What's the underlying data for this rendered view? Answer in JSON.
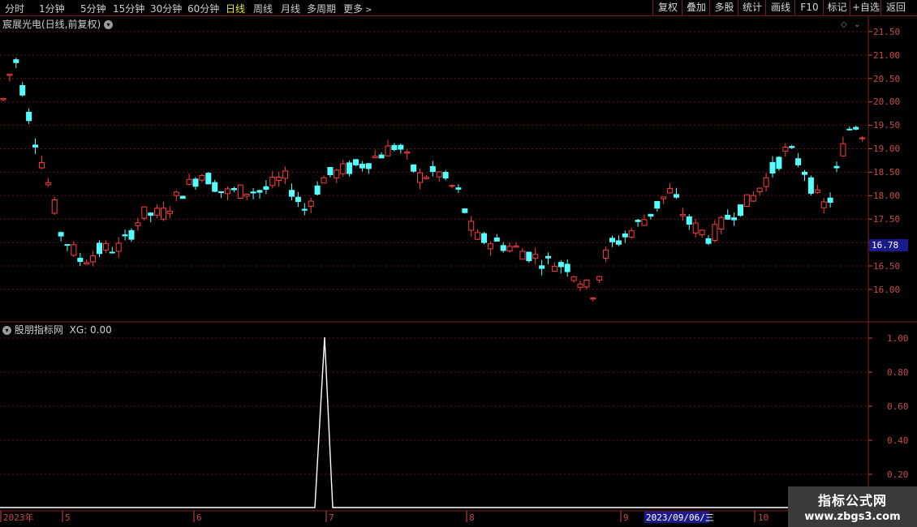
{
  "toolbar": {
    "timeframes": [
      "分时",
      "1分钟",
      "5分钟",
      "15分钟",
      "30分钟",
      "60分钟",
      "日线",
      "周线",
      "月线",
      "多周期",
      "更多"
    ],
    "active": "日线",
    "right_buttons": [
      "复权",
      "叠加",
      "多股",
      "统计",
      "画线",
      "F10",
      "标记",
      "+自选",
      "返回"
    ]
  },
  "chart": {
    "title": "宸展光电(日线,前复权)",
    "price_axis": [
      "21.50",
      "21.00",
      "20.50",
      "20.00",
      "19.50",
      "19.00",
      "18.50",
      "18.00",
      "17.50",
      "17.00",
      "16.50",
      "16.00"
    ],
    "current_price": "16.78",
    "colors": {
      "up": "#ff3c3c",
      "down": "#54ffff",
      "grid": "#6a1010",
      "axis": "#c84a4a",
      "tag_bg": "#1a1a8c"
    }
  },
  "indicator": {
    "title": "股朋指标网",
    "value_text": "XG: 0.00",
    "axis": [
      "1.00",
      "0.80",
      "0.60",
      "0.40",
      "0.20"
    ]
  },
  "time_axis": {
    "labels": [
      "2023年",
      "5",
      "6",
      "7",
      "8",
      "9",
      "10"
    ],
    "cursor_date": "2023/09/06/三"
  },
  "watermark": {
    "line1": "指标公式网",
    "line2": "www.zbgs3.com"
  }
}
